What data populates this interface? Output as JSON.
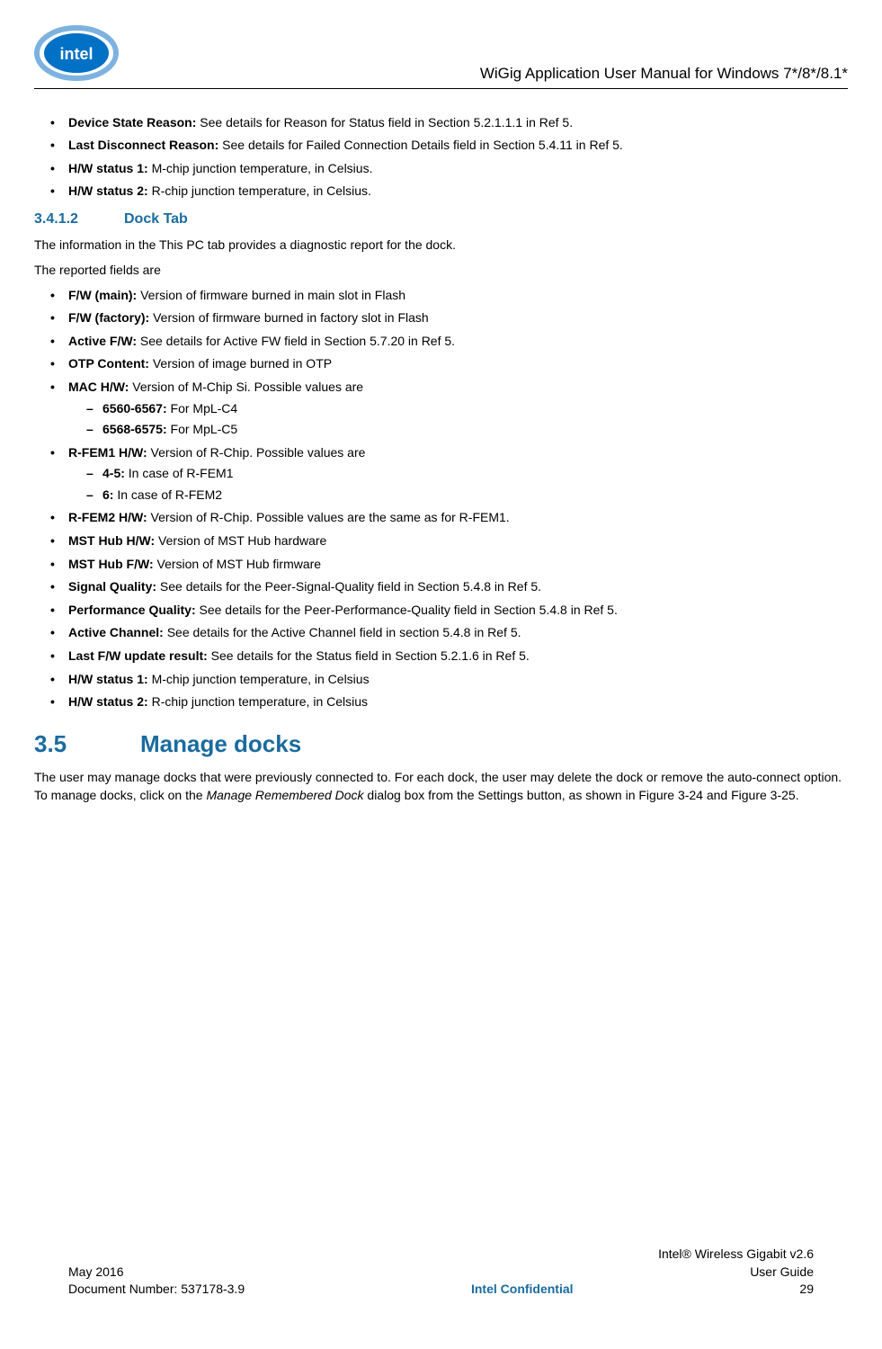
{
  "header": {
    "title": "WiGig Application User Manual for Windows 7*/8*/8.1*"
  },
  "top_bullets": [
    {
      "label": "Device State Reason:",
      "text": " See details for Reason for Status field in Section 5.2.1.1.1 in Ref 5."
    },
    {
      "label": "Last Disconnect Reason:",
      "text": " See details for Failed Connection Details field in Section 5.4.11 in Ref 5."
    },
    {
      "label": "H/W status 1:",
      "text": " M-chip junction temperature, in Celsius."
    },
    {
      "label": "H/W status 2:",
      "text": " R-chip junction temperature, in Celsius."
    }
  ],
  "section_3412": {
    "num": "3.4.1.2",
    "title": "Dock Tab",
    "intro": "The information in the This PC tab provides a diagnostic report for the dock.",
    "intro2": "The reported fields are"
  },
  "dock_bullets": [
    {
      "label": "F/W (main):",
      "text": " Version of firmware burned in main slot in Flash"
    },
    {
      "label": "F/W (factory):",
      "text": " Version of firmware burned in factory slot in Flash"
    },
    {
      "label": "Active F/W:",
      "text": " See details for Active FW field in Section 5.7.20 in Ref 5."
    },
    {
      "label": "OTP Content:",
      "text": " Version of image burned in OTP"
    },
    {
      "label": "MAC H/W:",
      "text": " Version of M-Chip Si. Possible values are",
      "sub": [
        {
          "label": "6560-6567:",
          "text": " For MpL-C4"
        },
        {
          "label": "6568-6575:",
          "text": " For MpL-C5"
        }
      ]
    },
    {
      "label": "R-FEM1 H/W:",
      "text": " Version of R-Chip. Possible values are",
      "sub": [
        {
          "label": "4-5:",
          "text": " In case of R-FEM1"
        },
        {
          "label": "6:",
          "text": " In case of R-FEM2"
        }
      ]
    },
    {
      "label": "R-FEM2 H/W:",
      "text": " Version of R-Chip. Possible values are the same as for R-FEM1."
    },
    {
      "label": "MST Hub H/W:",
      "text": " Version of MST Hub hardware"
    },
    {
      "label": "MST Hub F/W:",
      "text": " Version of MST Hub firmware"
    },
    {
      "label": "Signal Quality:",
      "text": " See details for the Peer-Signal-Quality field in Section 5.4.8 in Ref 5."
    },
    {
      "label": "Performance Quality:",
      "text": " See details for the Peer-Performance-Quality field in Section 5.4.8 in Ref 5."
    },
    {
      "label": "Active Channel:",
      "text": " See details for the Active Channel field in section 5.4.8 in Ref 5."
    },
    {
      "label": "Last F/W update result:",
      "text": " See details for the Status field in Section 5.2.1.6 in Ref 5."
    },
    {
      "label": "H/W status 1:",
      "text": " M-chip junction temperature, in Celsius"
    },
    {
      "label": "H/W status 2:",
      "text": " R-chip junction temperature, in Celsius"
    }
  ],
  "section_35": {
    "num": "3.5",
    "title": "Manage docks",
    "para_pre": "The user may manage docks that were previously connected to. For each dock, the user may delete the dock or remove the auto-connect option. To manage docks, click on the ",
    "para_italic": "Manage Remembered Dock",
    "para_post": " dialog box from the Settings button, as shown in Figure 3-24 and Figure 3-25."
  },
  "footer": {
    "topright": "Intel® Wireless Gigabit v2.6",
    "left1": "May 2016",
    "right1": "User Guide",
    "left2": "Document Number: 537178-3.9",
    "center2": "Intel Confidential",
    "right2": "29"
  }
}
